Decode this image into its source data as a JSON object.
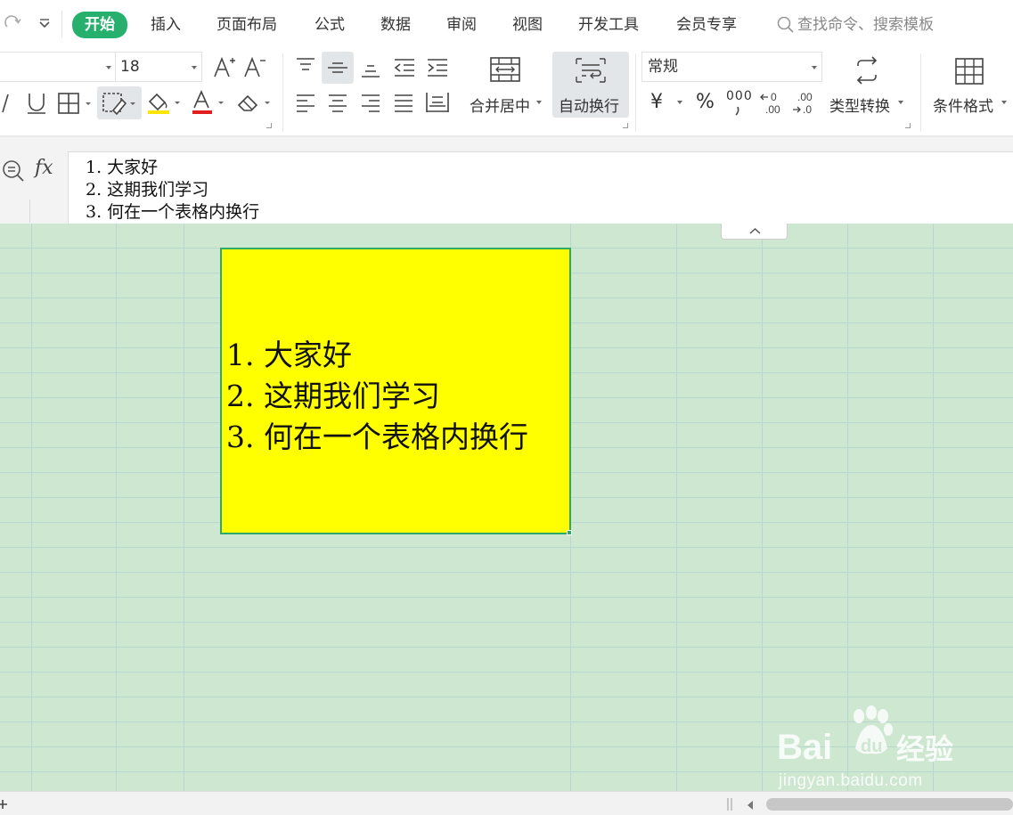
{
  "menubar": {
    "tabs": [
      {
        "label": "开始",
        "active": true
      },
      {
        "label": "插入"
      },
      {
        "label": "页面布局"
      },
      {
        "label": "公式"
      },
      {
        "label": "数据"
      },
      {
        "label": "审阅"
      },
      {
        "label": "视图"
      },
      {
        "label": "开发工具"
      },
      {
        "label": "会员专享"
      }
    ],
    "search_placeholder": "查找命令、搜索模板"
  },
  "ribbon": {
    "font_size": "18",
    "merge_center_label": "合并居中",
    "wrap_text_label": "自动换行",
    "number_format": "常规",
    "currency_symbol": "¥",
    "percent_symbol": "%",
    "thousands_symbol": "000",
    "type_convert_label": "类型转换",
    "conditional_format_label": "条件格式"
  },
  "formula_bar": {
    "fx_label": "fx",
    "lines": [
      "1. 大家好",
      "2. 这期我们学习",
      "3. 何在一个表格内换行"
    ]
  },
  "cell": {
    "lines": [
      "1. 大家好",
      "2. 这期我们学习",
      "3. 何在一个表格内换行"
    ],
    "fill_color": "#ffff00",
    "border_color": "#2ea866"
  },
  "watermark": {
    "logo_text": "Bai 经验",
    "url": "jingyan.baidu.com"
  },
  "colors": {
    "accent": "#27b06d",
    "sheet_bg": "#cee7d0"
  }
}
